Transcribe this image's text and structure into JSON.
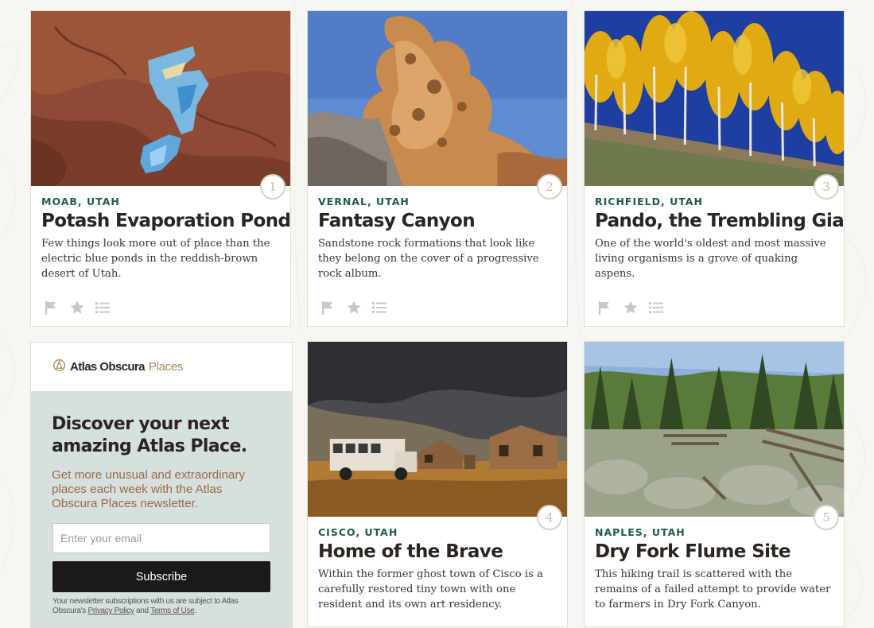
{
  "places": [
    {
      "number": "1",
      "location": "MOAB, UTAH",
      "title": "Potash Evaporation Ponds",
      "description": "Few things look more out of place than the electric blue ponds in the reddish-brown desert of Utah."
    },
    {
      "number": "2",
      "location": "VERNAL, UTAH",
      "title": "Fantasy Canyon",
      "description": "Sandstone rock formations that look like they belong on the cover of a progressive rock album."
    },
    {
      "number": "3",
      "location": "RICHFIELD, UTAH",
      "title": "Pando, the Trembling Giant",
      "description": "One of the world's oldest and most massive living organisms is a grove of quaking aspens."
    },
    {
      "number": "4",
      "location": "CISCO, UTAH",
      "title": "Home of the Brave",
      "description": "Within the former ghost town of Cisco is a carefully restored tiny town with one resident and its own art residency."
    },
    {
      "number": "5",
      "location": "NAPLES, UTAH",
      "title": "Dry Fork Flume Site",
      "description": "This hiking trail is scattered with the remains of a failed attempt to provide water to farmers in Dry Fork Canyon."
    }
  ],
  "actions": {
    "flag_icon": "flag-icon",
    "star_icon": "star-icon",
    "list_icon": "list-icon"
  },
  "newsletter": {
    "brand": "Atlas Obscura",
    "brand_suffix": "Places",
    "headline": "Discover your next amazing Atlas Place.",
    "text": "Get more unusual and extraordinary places each week with the Atlas Obscura Places newsletter.",
    "email_placeholder": "Enter your email",
    "subscribe_label": "Subscribe",
    "fine_print_prefix": "Your newsletter subscriptions with us are subject to Atlas Obscura's",
    "privacy_link": "Privacy Policy",
    "and_text": "and",
    "terms_link": "Terms of Use",
    "period": "."
  },
  "colors": {
    "location": "#1f5b4f",
    "accent": "#a5895a",
    "promo_bg": "#d6e0df",
    "button": "#1c1a19"
  }
}
